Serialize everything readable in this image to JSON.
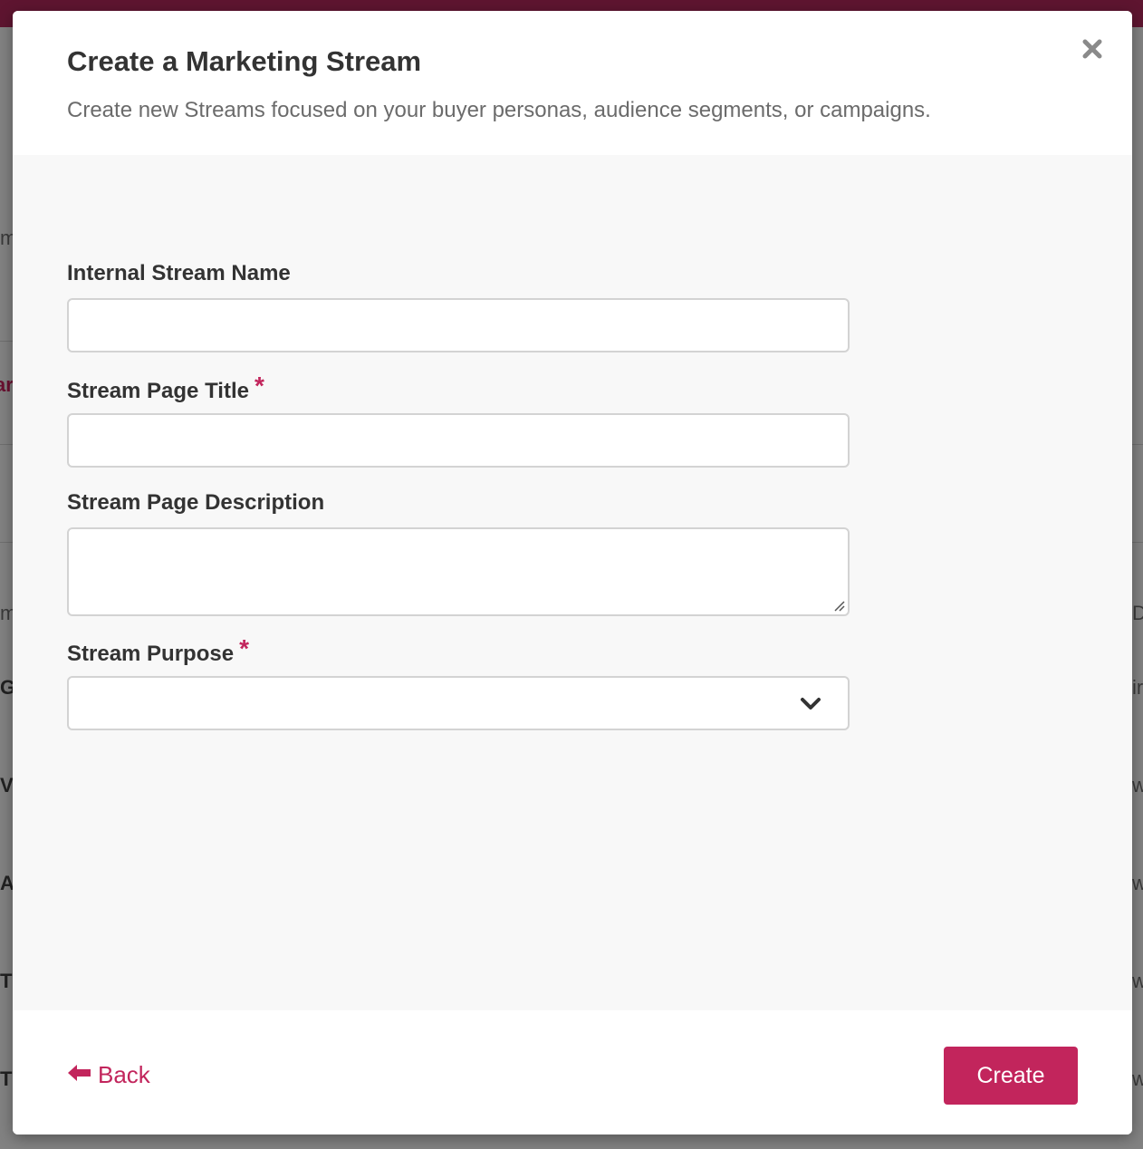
{
  "modal": {
    "title": "Create a Marketing Stream",
    "subtitle": "Create new Streams focused on your buyer personas, audience segments, or campaigns.",
    "close_icon": "close-icon"
  },
  "form": {
    "internal_name": {
      "label": "Internal Stream Name",
      "value": "",
      "required": false
    },
    "page_title": {
      "label": "Stream Page Title",
      "required_mark": "*",
      "value": "",
      "required": true
    },
    "page_description": {
      "label": "Stream Page Description",
      "value": "",
      "required": false
    },
    "purpose": {
      "label": "Stream Purpose",
      "required_mark": "*",
      "selected": "",
      "required": true,
      "icon": "chevron-down-icon"
    }
  },
  "footer": {
    "back_label": "Back",
    "back_icon": "arrow-left-icon",
    "create_label": "Create"
  },
  "colors": {
    "accent": "#c2255c",
    "title": "#333333",
    "subtitle": "#6b6b6b",
    "body_bg": "#f8f8f8"
  },
  "background_fragments": [
    "m",
    "ar",
    "m",
    "G",
    "V",
    "A",
    "T",
    "T",
    "D",
    "ir",
    "w",
    "w",
    "w",
    "w"
  ]
}
